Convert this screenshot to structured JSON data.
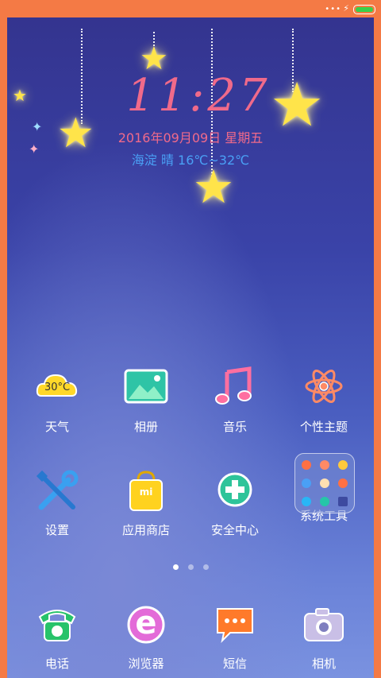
{
  "status": {
    "signal_dots": "•••",
    "charging_icon": "bolt-icon",
    "battery_color": "#39d04a"
  },
  "clock": {
    "time": "11:27",
    "date": "2016年09月09日  星期五",
    "weather": "海淀 晴 16℃~32℃"
  },
  "apps": [
    {
      "label": "天气",
      "icon": "weather-cloud-icon",
      "badge": "30°C"
    },
    {
      "label": "相册",
      "icon": "gallery-icon"
    },
    {
      "label": "音乐",
      "icon": "music-note-icon"
    },
    {
      "label": "个性主题",
      "icon": "theme-atom-icon"
    },
    {
      "label": "设置",
      "icon": "settings-tools-icon"
    },
    {
      "label": "应用商店",
      "icon": "app-store-bag-icon",
      "badge": "mi"
    },
    {
      "label": "安全中心",
      "icon": "security-plus-icon"
    },
    {
      "label": "系统工具",
      "icon": "folder-icon"
    }
  ],
  "dock": [
    {
      "label": "电话",
      "icon": "phone-icon"
    },
    {
      "label": "浏览器",
      "icon": "browser-e-icon",
      "badge": "e"
    },
    {
      "label": "短信",
      "icon": "message-icon"
    },
    {
      "label": "相机",
      "icon": "camera-icon"
    }
  ],
  "page_indicator": {
    "pages": 3,
    "current": 1
  },
  "colors": {
    "frame": "#f47a45",
    "clock": "#f06a8a",
    "weather": "#4aa0f5",
    "star": "#ffe44a"
  }
}
